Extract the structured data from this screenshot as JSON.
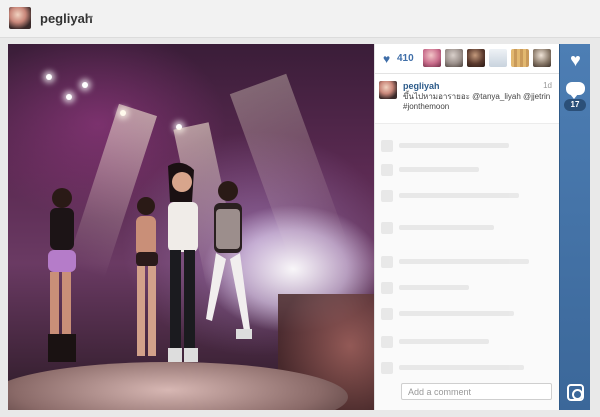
{
  "header": {
    "username": "pegliyah",
    "dropdown_caret": "▾"
  },
  "post": {
    "likes_count": "410",
    "likers": [
      {
        "name": "liker-1",
        "color": "#c86b8a"
      },
      {
        "name": "liker-2",
        "color": "#9a8f8a"
      },
      {
        "name": "liker-3",
        "color": "#5b3a2e"
      },
      {
        "name": "liker-4",
        "color": "#c9d3de"
      },
      {
        "name": "liker-5",
        "color": "#c99a5a"
      },
      {
        "name": "liker-6",
        "color": "#8a7a6a"
      }
    ],
    "caption": {
      "username": "pegliyah",
      "time": "1d",
      "text": "ขึ้นไปหามอารายอะ @tanya_liyah @jjetrin #jonthemoon"
    },
    "add_comment_placeholder": "Add a comment",
    "comments_count": "17"
  },
  "icons": {
    "like": "heart-icon",
    "comment": "comment-icon",
    "instagram": "instagram-icon"
  },
  "colors": {
    "accent": "#3f6ea8",
    "action_bar": "#4d7eb4",
    "badge": "#2b4f78"
  }
}
